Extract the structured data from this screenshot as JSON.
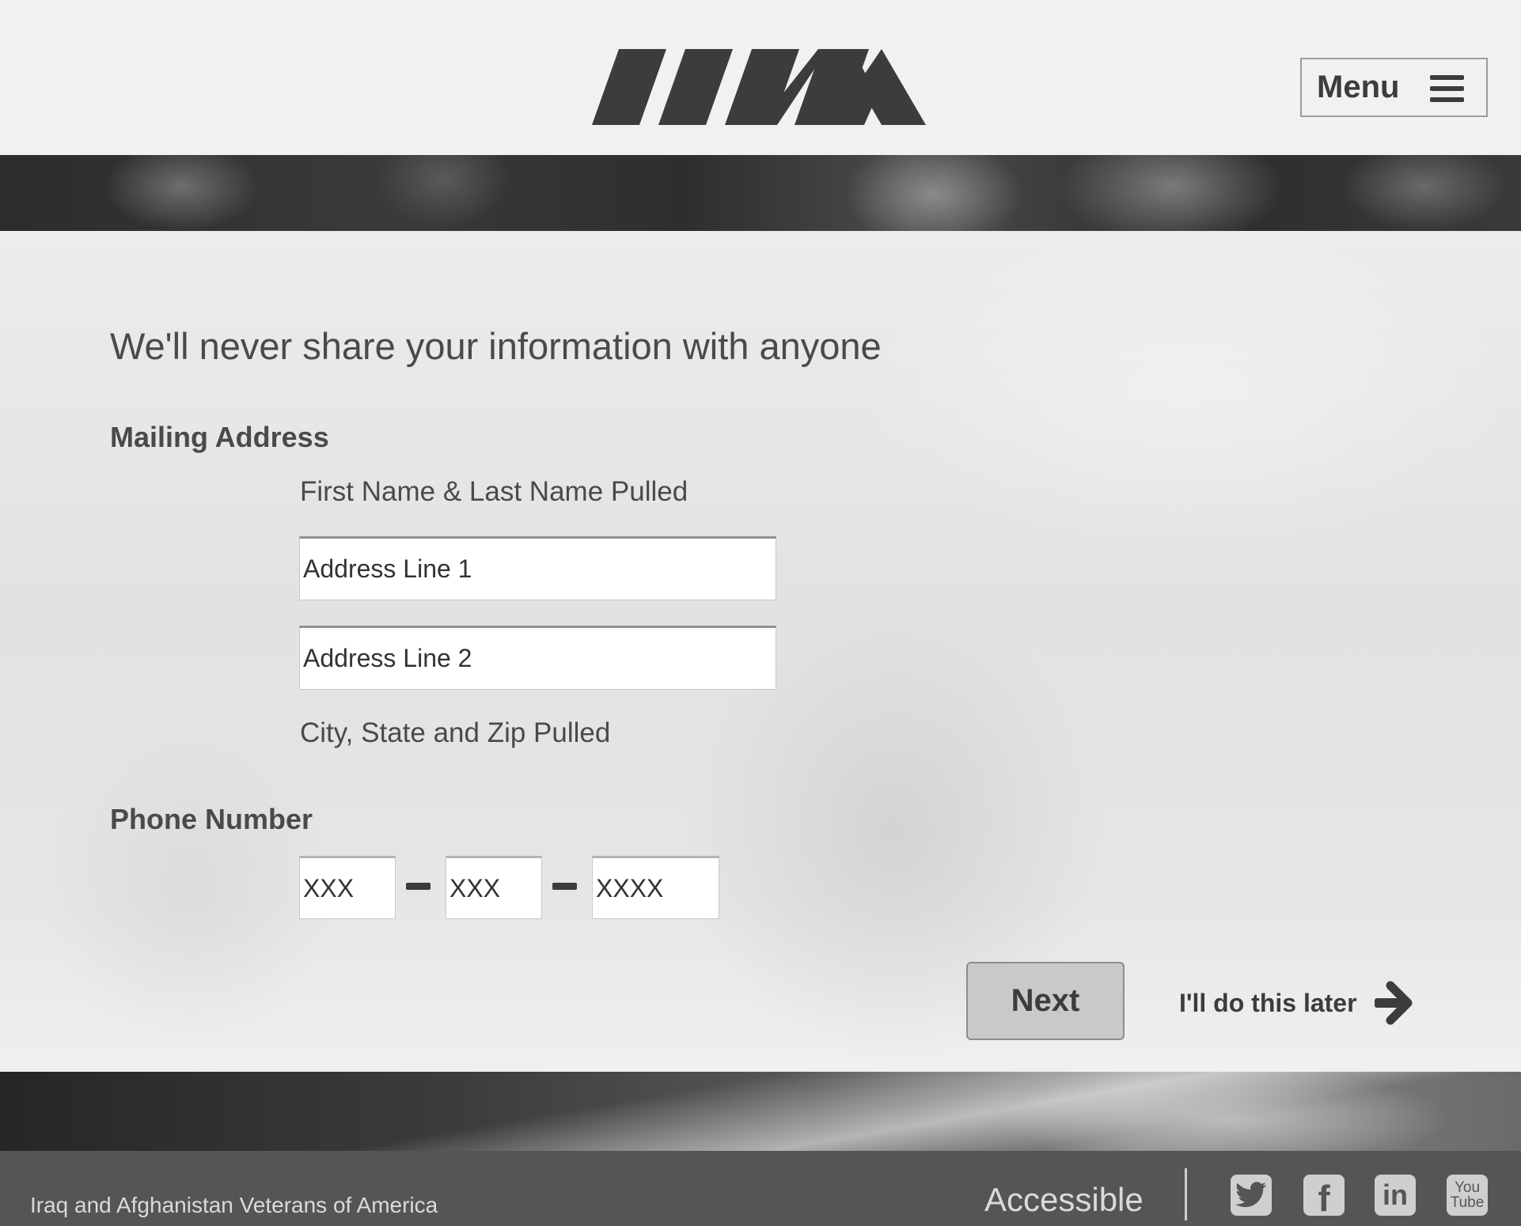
{
  "header": {
    "logo_alt": "IAVA",
    "menu_label": "Menu"
  },
  "main": {
    "heading": "We'll never share your information with anyone",
    "mailing": {
      "label": "Mailing Address",
      "name_line": "First Name & Last Name Pulled",
      "address_line_1_placeholder": "Address Line 1",
      "address_line_2_placeholder": "Address Line 2",
      "city_line": "City, State and Zip Pulled"
    },
    "phone": {
      "label": "Phone Number",
      "area_placeholder": "XXX",
      "prefix_placeholder": "XXX",
      "line_placeholder": "XXXX"
    },
    "next_label": "Next",
    "later_label": "I'll do this later"
  },
  "footer": {
    "org_name": "Iraq and Afghanistan Veterans of America",
    "accessible_label": "Accessible",
    "social": {
      "facebook_glyph": "f",
      "linkedin_glyph": "in",
      "youtube_glyph_top": "You",
      "youtube_glyph_bottom": "Tube"
    }
  },
  "colors": {
    "header_bg": "#f1f1f1",
    "text": "#4a4a4a",
    "dark": "#3c3c3c",
    "footer_bg": "#555555",
    "button_bg": "#c9c9c9"
  },
  "icons": [
    "iava-logo-icon",
    "hamburger-icon",
    "arrow-right-icon",
    "twitter-icon",
    "facebook-icon",
    "linkedin-icon",
    "youtube-icon"
  ]
}
